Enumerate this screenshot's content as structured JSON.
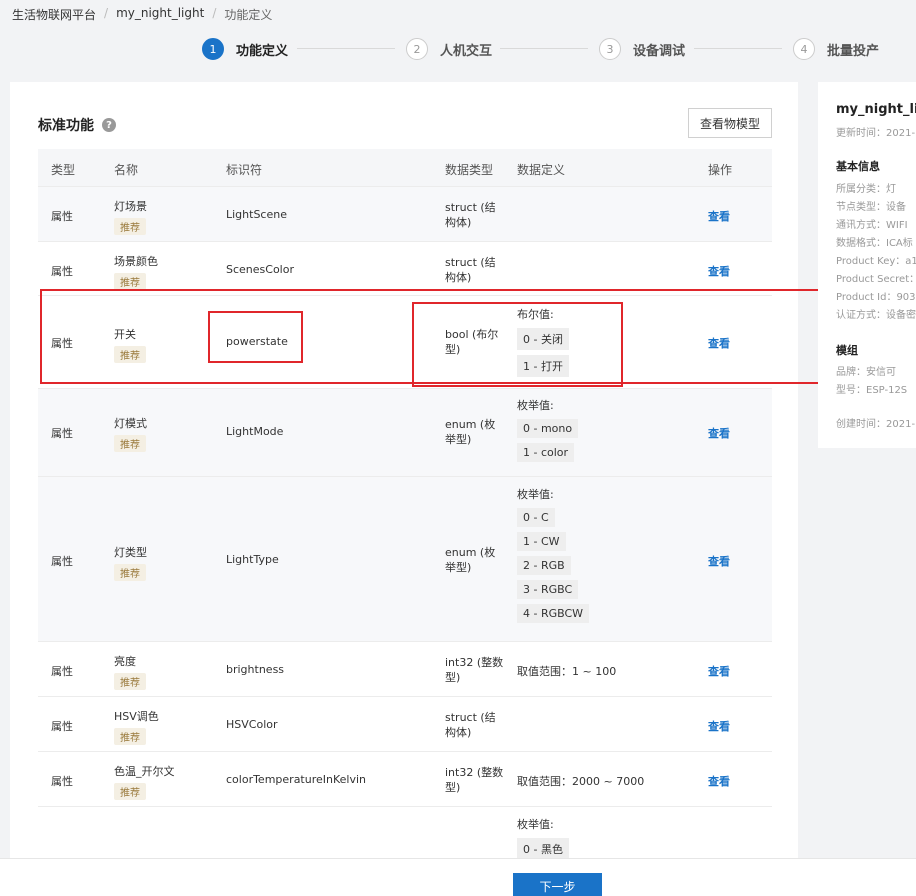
{
  "breadcrumb": [
    "生活物联网平台",
    "my_night_light",
    "功能定义"
  ],
  "steps": [
    {
      "num": "1",
      "label": "功能定义"
    },
    {
      "num": "2",
      "label": "人机交互"
    },
    {
      "num": "3",
      "label": "设备调试"
    },
    {
      "num": "4",
      "label": "批量投产"
    }
  ],
  "main": {
    "title": "标准功能",
    "help_icon": "?",
    "view_model_button": "查看物模型",
    "columns": [
      "类型",
      "名称",
      "标识符",
      "数据类型",
      "数据定义",
      "操作"
    ],
    "rows": [
      {
        "type": "属性",
        "name": "灯场景",
        "badge": "推荐",
        "identifier": "LightScene",
        "dtype": "struct (结构体)",
        "def_title": "",
        "def_items": [],
        "op": "查看"
      },
      {
        "type": "属性",
        "name": "场景颜色",
        "badge": "推荐",
        "identifier": "ScenesColor",
        "dtype": "struct (结构体)",
        "def_title": "",
        "def_items": [],
        "op": "查看"
      },
      {
        "type": "属性",
        "name": "开关",
        "badge": "推荐",
        "identifier": "powerstate",
        "dtype": "bool (布尔型)",
        "def_title": "布尔值:",
        "def_items": [
          "0 - 关闭",
          "1 - 打开"
        ],
        "op": "查看"
      },
      {
        "type": "属性",
        "name": "灯模式",
        "badge": "推荐",
        "identifier": "LightMode",
        "dtype": "enum (枚举型)",
        "def_title": "枚举值:",
        "def_items": [
          "0 - mono",
          "1 - color"
        ],
        "op": "查看"
      },
      {
        "type": "属性",
        "name": "灯类型",
        "badge": "推荐",
        "identifier": "LightType",
        "dtype": "enum (枚举型)",
        "def_title": "枚举值:",
        "def_items": [
          "0 - C",
          "1 - CW",
          "2 - RGB",
          "3 - RGBC",
          "4 - RGBCW"
        ],
        "op": "查看"
      },
      {
        "type": "属性",
        "name": "亮度",
        "badge": "推荐",
        "identifier": "brightness",
        "dtype": "int32 (整数型)",
        "def_title": "取值范围：1 ~ 100",
        "def_items": [],
        "op": "查看"
      },
      {
        "type": "属性",
        "name": "HSV调色",
        "badge": "推荐",
        "identifier": "HSVColor",
        "dtype": "struct (结构体)",
        "def_title": "",
        "def_items": [],
        "op": "查看"
      },
      {
        "type": "属性",
        "name": "色温_开尔文",
        "badge": "推荐",
        "identifier": "colorTemperatureInKelvin",
        "dtype": "int32 (整数型)",
        "def_title": "取值范围：2000 ~ 7000",
        "def_items": [],
        "op": "查看"
      },
      {
        "type": "",
        "name": "",
        "badge": "",
        "identifier": "",
        "dtype": "",
        "def_title": "枚举值:",
        "def_items": [
          "0 - 黑色"
        ],
        "op": ""
      }
    ]
  },
  "side": {
    "product_name": "my_night_ligh",
    "updated": "更新时间：2021-",
    "basic_title": "基本信息",
    "basic_lines": [
      "所属分类：灯",
      "节点类型：设备",
      "通讯方式：WIFI",
      "数据格式：ICA标",
      "Product Key：a1",
      "Product Secret：",
      "Product Id：903",
      "认证方式：设备密"
    ],
    "module_title": "模组",
    "module_lines": [
      "品牌：安信可",
      "型号：ESP-12S"
    ],
    "created": "创建时间：2021-"
  },
  "footer": {
    "next_button": "下一步"
  }
}
